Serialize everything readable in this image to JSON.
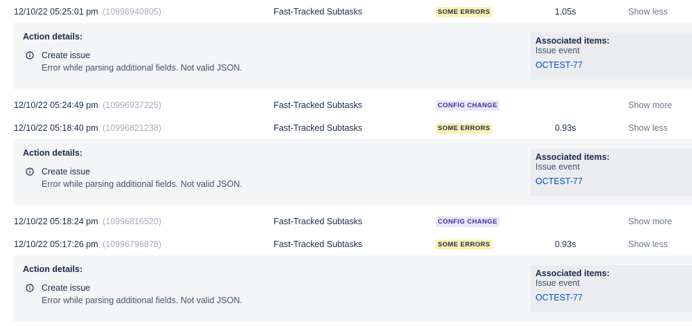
{
  "entries": [
    {
      "date": "12/10/22 05:25:01 pm",
      "id": "(10996940805)",
      "rule": "Fast-Tracked Subtasks",
      "status": "SOME ERRORS",
      "duration": "1.05s",
      "toggle": "Show less",
      "details": {
        "heading": "Action details:",
        "action": "Create issue",
        "error": "Error while parsing additional fields. Not valid JSON.",
        "assoc_title": "Associated items:",
        "assoc_type": "Issue event",
        "assoc_link": "OCTEST-77"
      }
    },
    {
      "date": "12/10/22 05:24:49 pm",
      "id": "(10996937225)",
      "rule": "Fast-Tracked Subtasks",
      "status": "CONFIG CHANGE",
      "duration": "",
      "toggle": "Show more"
    },
    {
      "date": "12/10/22 05:18:40 pm",
      "id": "(10996821238)",
      "rule": "Fast-Tracked Subtasks",
      "status": "SOME ERRORS",
      "duration": "0.93s",
      "toggle": "Show less",
      "details": {
        "heading": "Action details:",
        "action": "Create issue",
        "error": "Error while parsing additional fields. Not valid JSON.",
        "assoc_title": "Associated items:",
        "assoc_type": "Issue event",
        "assoc_link": "OCTEST-77"
      }
    },
    {
      "date": "12/10/22 05:18:24 pm",
      "id": "(10996816520)",
      "rule": "Fast-Tracked Subtasks",
      "status": "CONFIG CHANGE",
      "duration": "",
      "toggle": "Show more"
    },
    {
      "date": "12/10/22 05:17:26 pm",
      "id": "(10996796878)",
      "rule": "Fast-Tracked Subtasks",
      "status": "SOME ERRORS",
      "duration": "0.93s",
      "toggle": "Show less",
      "details": {
        "heading": "Action details:",
        "action": "Create issue",
        "error": "Error while parsing additional fields. Not valid JSON.",
        "assoc_title": "Associated items:",
        "assoc_type": "Issue event",
        "assoc_link": "OCTEST-77"
      }
    }
  ],
  "colors": {
    "some_errors_bg": "#fff0b3",
    "config_change_bg": "#eae6ff",
    "config_change_text": "#403294",
    "link": "#0052cc",
    "id_text": "#a5adba",
    "details_bg": "#f4f5f7"
  },
  "icons": {
    "action_icon": "info-icon"
  }
}
